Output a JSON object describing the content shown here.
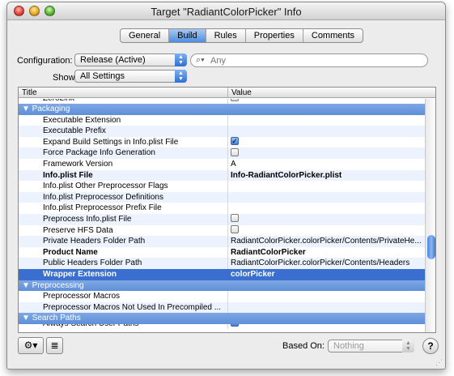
{
  "window": {
    "title": "Target \"RadiantColorPicker\" Info"
  },
  "tabs": [
    {
      "label": "General",
      "active": false
    },
    {
      "label": "Build",
      "active": true
    },
    {
      "label": "Rules",
      "active": false
    },
    {
      "label": "Properties",
      "active": false
    },
    {
      "label": "Comments",
      "active": false
    }
  ],
  "configuration": {
    "label": "Configuration:",
    "value": "Release (Active)"
  },
  "show": {
    "label": "Show:",
    "value": "All Settings"
  },
  "search": {
    "placeholder": "Any",
    "value": ""
  },
  "table": {
    "headers": {
      "title": "Title",
      "value": "Value"
    },
    "rows": [
      {
        "kind": "clip",
        "title": "ZeroLink",
        "value": "",
        "checkbox": "off"
      },
      {
        "kind": "group",
        "title": "▼ Packaging",
        "value": ""
      },
      {
        "kind": "item",
        "title": "Executable Extension",
        "value": ""
      },
      {
        "kind": "item",
        "title": "Executable Prefix",
        "value": ""
      },
      {
        "kind": "item",
        "title": "Expand Build Settings in Info.plist File",
        "value": "",
        "checkbox": "on"
      },
      {
        "kind": "item",
        "title": "Force Package Info Generation",
        "value": "",
        "checkbox": "off"
      },
      {
        "kind": "item",
        "title": "Framework Version",
        "value": "A"
      },
      {
        "kind": "bold",
        "title": "Info.plist File",
        "value": "Info-RadiantColorPicker.plist"
      },
      {
        "kind": "item",
        "title": "Info.plist Other Preprocessor Flags",
        "value": ""
      },
      {
        "kind": "item",
        "title": "Info.plist Preprocessor Definitions",
        "value": ""
      },
      {
        "kind": "item",
        "title": "Info.plist Preprocessor Prefix File",
        "value": ""
      },
      {
        "kind": "item",
        "title": "Preprocess Info.plist File",
        "value": "",
        "checkbox": "off"
      },
      {
        "kind": "item",
        "title": "Preserve HFS Data",
        "value": "",
        "checkbox": "off"
      },
      {
        "kind": "item",
        "title": "Private Headers Folder Path",
        "value": "RadiantColorPicker.colorPicker/Contents/PrivateHe..."
      },
      {
        "kind": "bold",
        "title": "Product Name",
        "value": "RadiantColorPicker"
      },
      {
        "kind": "item",
        "title": "Public Headers Folder Path",
        "value": "RadiantColorPicker.colorPicker/Contents/Headers"
      },
      {
        "kind": "selected",
        "title": "Wrapper Extension",
        "value": "colorPicker"
      },
      {
        "kind": "group",
        "title": "▼ Preprocessing",
        "value": ""
      },
      {
        "kind": "item",
        "title": "Preprocessor Macros",
        "value": ""
      },
      {
        "kind": "item",
        "title": "Preprocessor Macros Not Used In Precompiled ...",
        "value": ""
      },
      {
        "kind": "group",
        "title": "▼ Search Paths",
        "value": ""
      },
      {
        "kind": "clip",
        "title": "Always Search User Paths",
        "value": "",
        "checkbox": "on"
      }
    ]
  },
  "bottom": {
    "gear_icon": "⚙▾",
    "notes_icon": "≣",
    "based_on_label": "Based On:",
    "based_on_value": "Nothing",
    "help_label": "?"
  },
  "colors": {
    "selection": "#3a6fd0",
    "group_header": "#6a98dd",
    "alt_row": "#edf3fe"
  }
}
